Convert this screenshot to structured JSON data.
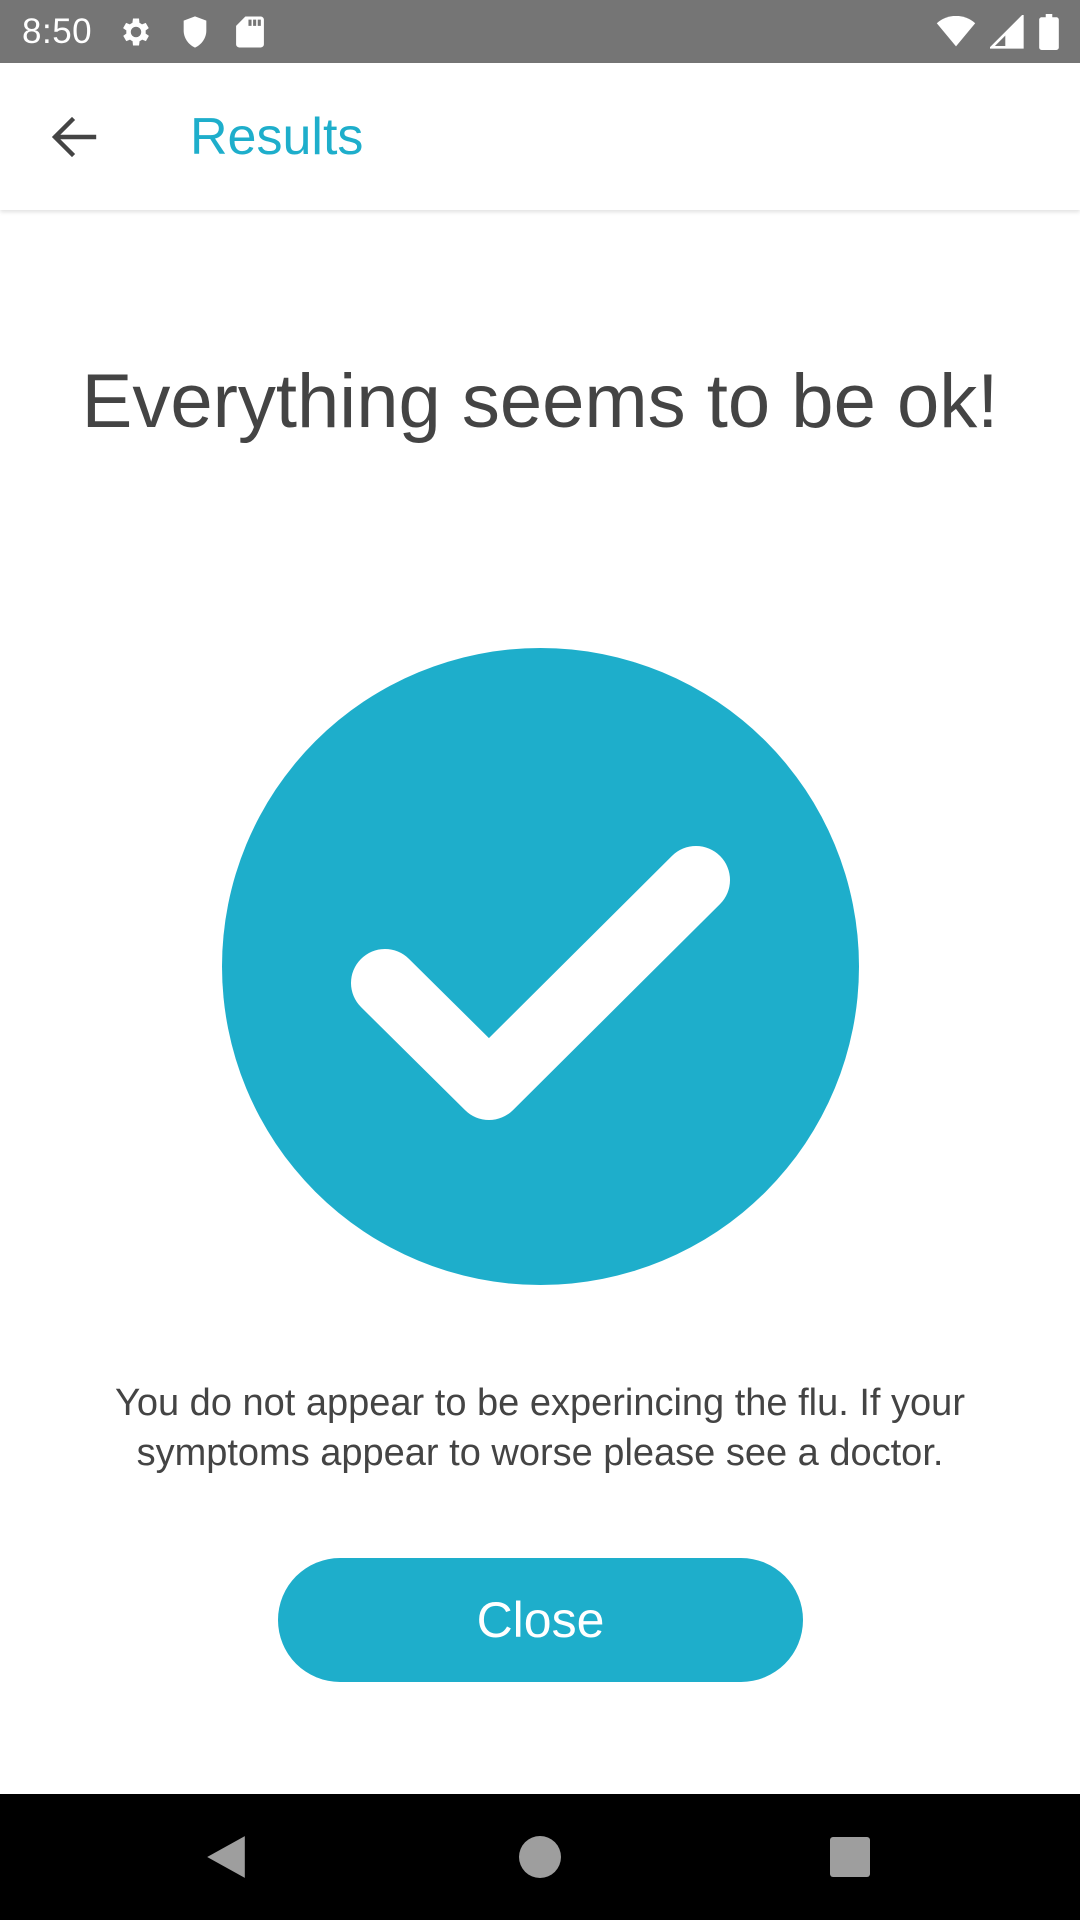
{
  "status_bar": {
    "time": "8:50",
    "icons": [
      "settings-icon",
      "shield-icon",
      "sd-card-icon",
      "wifi-icon",
      "signal-icon",
      "battery-icon"
    ]
  },
  "app_bar": {
    "title": "Results",
    "back_icon": "arrow-back-icon"
  },
  "content": {
    "headline": "Everything seems to be ok!",
    "status_icon": "check-circle-icon",
    "message": "You do not appear to be experincing the flu. If your symptoms appear to worse please see a doctor.",
    "close_label": "Close"
  },
  "nav_bar": {
    "icons": [
      "nav-back-icon",
      "nav-home-icon",
      "nav-recents-icon"
    ]
  },
  "colors": {
    "accent": "#1eaecb",
    "text_primary": "#444444",
    "status_bar": "#757575",
    "nav_bar": "#000000"
  }
}
